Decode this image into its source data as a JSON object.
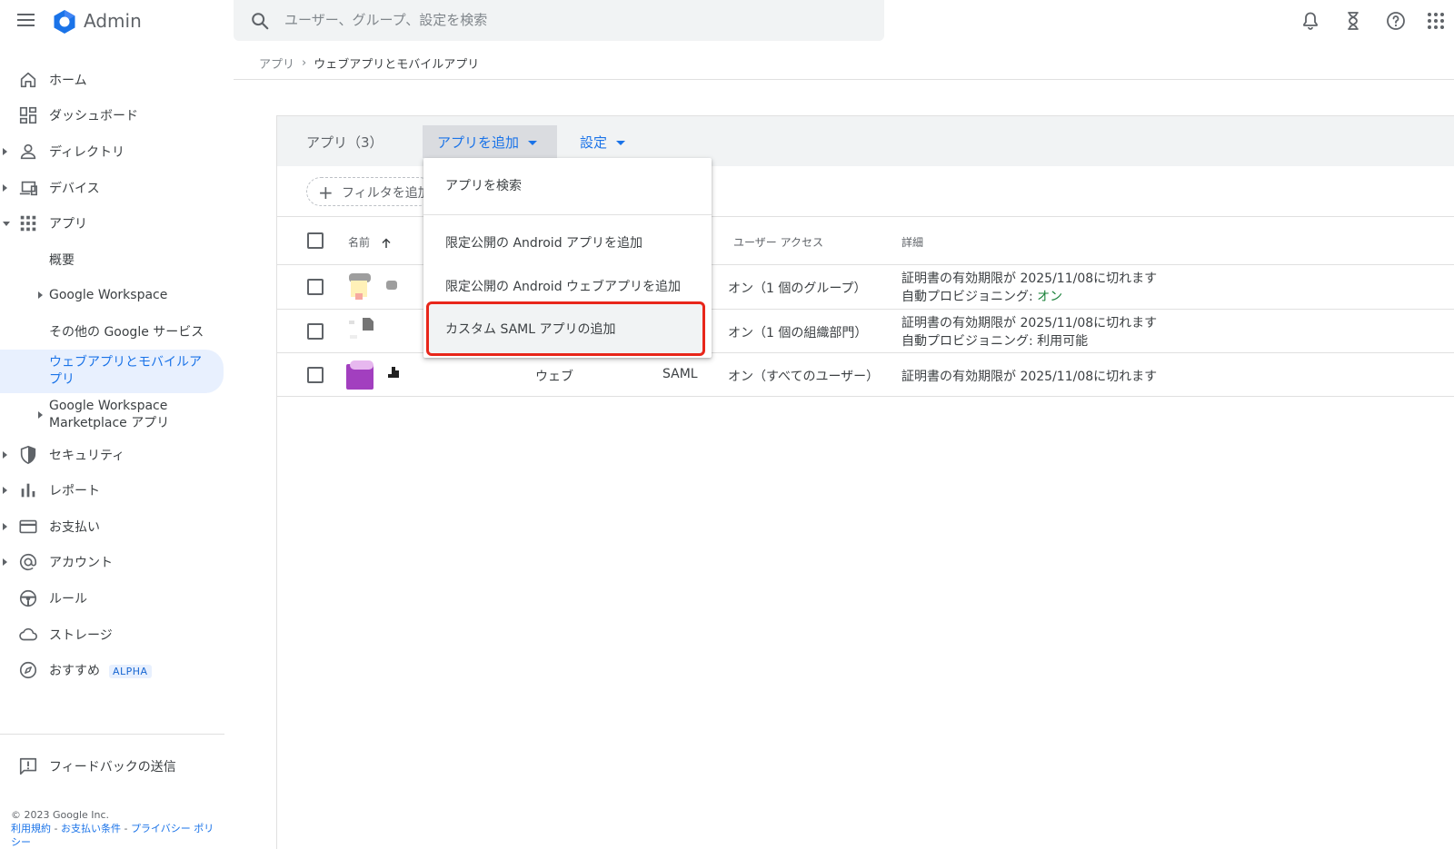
{
  "app": {
    "brand": "Admin",
    "search_placeholder": "ユーザー、グループ、設定を検索"
  },
  "breadcrumb": {
    "parent": "アプリ",
    "separator": "›",
    "current": "ウェブアプリとモバイルアプリ"
  },
  "sidebar": {
    "items": [
      {
        "label": "ホーム"
      },
      {
        "label": "ダッシュボード"
      },
      {
        "label": "ディレクトリ"
      },
      {
        "label": "デバイス"
      },
      {
        "label": "アプリ"
      },
      {
        "label": "概要"
      },
      {
        "label": "Google Workspace"
      },
      {
        "label": "その他の Google サービス"
      },
      {
        "label": "ウェブアプリとモバイルアプリ"
      },
      {
        "label_line1": "Google Workspace",
        "label_line2": "Marketplace アプリ"
      },
      {
        "label": "セキュリティ"
      },
      {
        "label": "レポート"
      },
      {
        "label": "お支払い"
      },
      {
        "label": "アカウント"
      },
      {
        "label": "ルール"
      },
      {
        "label": "ストレージ"
      },
      {
        "label": "おすすめ",
        "badge": "ALPHA"
      }
    ],
    "feedback": "フィードバックの送信",
    "footer": {
      "copyright": "© 2023 Google Inc.",
      "terms": "利用規約",
      "payment_terms": "お支払い条件",
      "privacy": "プライバシー ポリシー",
      "dash": " - "
    }
  },
  "toolbar": {
    "apps_count": "アプリ（3）",
    "add_app": "アプリを追加",
    "settings": "設定"
  },
  "filter": {
    "label": "フィルタを追加"
  },
  "dropdown": {
    "items": [
      "アプリを検索",
      "限定公開の Android アプリを追加",
      "限定公開の Android ウェブアプリを追加",
      "カスタム SAML アプリの追加"
    ]
  },
  "table": {
    "headers": {
      "name": "名前",
      "sort_icon": "arrow-up-icon",
      "user_access": "ユーザー アクセス",
      "details": "詳細"
    },
    "rows": [
      {
        "type": "",
        "auth": "",
        "access": "オン（1 個のグループ）",
        "detail1": "証明書の有効期限が 2025/11/08に切れます",
        "detail2_prefix": "自動プロビジョニング: ",
        "detail2_value": "オン"
      },
      {
        "type": "",
        "auth": "",
        "access": "オン（1 個の組織部門）",
        "detail1": "証明書の有効期限が 2025/11/08に切れます",
        "detail2_prefix": "自動プロビジョニング: ",
        "detail2_value": "利用可能"
      },
      {
        "type": "ウェブ",
        "auth": "SAML",
        "access": "オン（すべてのユーザー）",
        "detail1": "証明書の有効期限が 2025/11/08に切れます",
        "detail2_prefix": "",
        "detail2_value": ""
      }
    ]
  },
  "colors": {
    "accent": "#1a73e8",
    "highlight": "#e8261a",
    "positive": "#188038"
  }
}
